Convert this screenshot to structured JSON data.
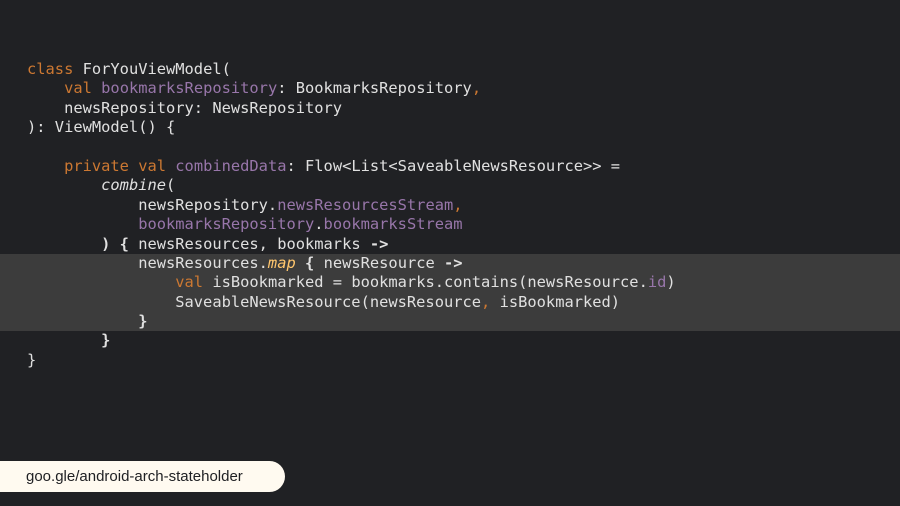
{
  "colors": {
    "background": "#202124",
    "highlight": "#3c3c3c",
    "keyword": "#cc7832",
    "property": "#9876aa",
    "text": "#e0e0e0",
    "extension_function": "#ffc66d",
    "link_pill": "#fffaf0"
  },
  "code_lines": [
    {
      "highlight": false,
      "tokens": [
        {
          "t": "class ",
          "c": "kw"
        },
        {
          "t": "ForYouViewModel(",
          "c": "plain"
        }
      ]
    },
    {
      "highlight": false,
      "tokens": [
        {
          "t": "    ",
          "c": "plain"
        },
        {
          "t": "val ",
          "c": "kw"
        },
        {
          "t": "bookmarksRepository",
          "c": "prop"
        },
        {
          "t": ": BookmarksRepository",
          "c": "plain"
        },
        {
          "t": ",",
          "c": "comma"
        }
      ]
    },
    {
      "highlight": false,
      "tokens": [
        {
          "t": "    newsRepository: NewsRepository",
          "c": "plain"
        }
      ]
    },
    {
      "highlight": false,
      "tokens": [
        {
          "t": "): ViewModel() {",
          "c": "plain"
        }
      ]
    },
    {
      "highlight": false,
      "tokens": []
    },
    {
      "highlight": false,
      "tokens": [
        {
          "t": "    ",
          "c": "plain"
        },
        {
          "t": "private val ",
          "c": "kw"
        },
        {
          "t": "combinedData",
          "c": "prop"
        },
        {
          "t": ": Flow<List<SaveableNewsResource>> =",
          "c": "plain"
        }
      ]
    },
    {
      "highlight": false,
      "tokens": [
        {
          "t": "        ",
          "c": "plain"
        },
        {
          "t": "combine",
          "c": "italic"
        },
        {
          "t": "(",
          "c": "plain"
        }
      ]
    },
    {
      "highlight": false,
      "tokens": [
        {
          "t": "            newsRepository.",
          "c": "plain"
        },
        {
          "t": "newsResourcesStream",
          "c": "prop"
        },
        {
          "t": ",",
          "c": "comma"
        }
      ]
    },
    {
      "highlight": false,
      "tokens": [
        {
          "t": "            ",
          "c": "plain"
        },
        {
          "t": "bookmarksRepository",
          "c": "prop"
        },
        {
          "t": ".",
          "c": "plain"
        },
        {
          "t": "bookmarksStream",
          "c": "prop"
        }
      ]
    },
    {
      "highlight": false,
      "tokens": [
        {
          "t": "        ",
          "c": "plain"
        },
        {
          "t": ") {",
          "c": "bold"
        },
        {
          "t": " newsResources, bookmarks ",
          "c": "plain"
        },
        {
          "t": "->",
          "c": "bold"
        }
      ]
    },
    {
      "highlight": true,
      "tokens": [
        {
          "t": "            newsResources.",
          "c": "plain"
        },
        {
          "t": "map",
          "c": "ext"
        },
        {
          "t": " ",
          "c": "plain"
        },
        {
          "t": "{",
          "c": "bold"
        },
        {
          "t": " newsResource ",
          "c": "plain"
        },
        {
          "t": "->",
          "c": "bold"
        }
      ]
    },
    {
      "highlight": true,
      "tokens": [
        {
          "t": "                ",
          "c": "plain"
        },
        {
          "t": "val ",
          "c": "kw"
        },
        {
          "t": "isBookmarked = bookmarks.contains(newsResource.",
          "c": "plain"
        },
        {
          "t": "id",
          "c": "prop"
        },
        {
          "t": ")",
          "c": "plain"
        }
      ]
    },
    {
      "highlight": true,
      "tokens": [
        {
          "t": "                SaveableNewsResource(newsResource",
          "c": "plain"
        },
        {
          "t": ",",
          "c": "comma"
        },
        {
          "t": " isBookmarked)",
          "c": "plain"
        }
      ]
    },
    {
      "highlight": true,
      "tokens": [
        {
          "t": "            ",
          "c": "plain"
        },
        {
          "t": "}",
          "c": "bold"
        }
      ]
    },
    {
      "highlight": false,
      "tokens": [
        {
          "t": "        ",
          "c": "plain"
        },
        {
          "t": "}",
          "c": "bold"
        }
      ]
    },
    {
      "highlight": false,
      "tokens": [
        {
          "t": "}",
          "c": "plain"
        }
      ]
    }
  ],
  "link": {
    "text": "goo.gle/android-arch-stateholder"
  }
}
